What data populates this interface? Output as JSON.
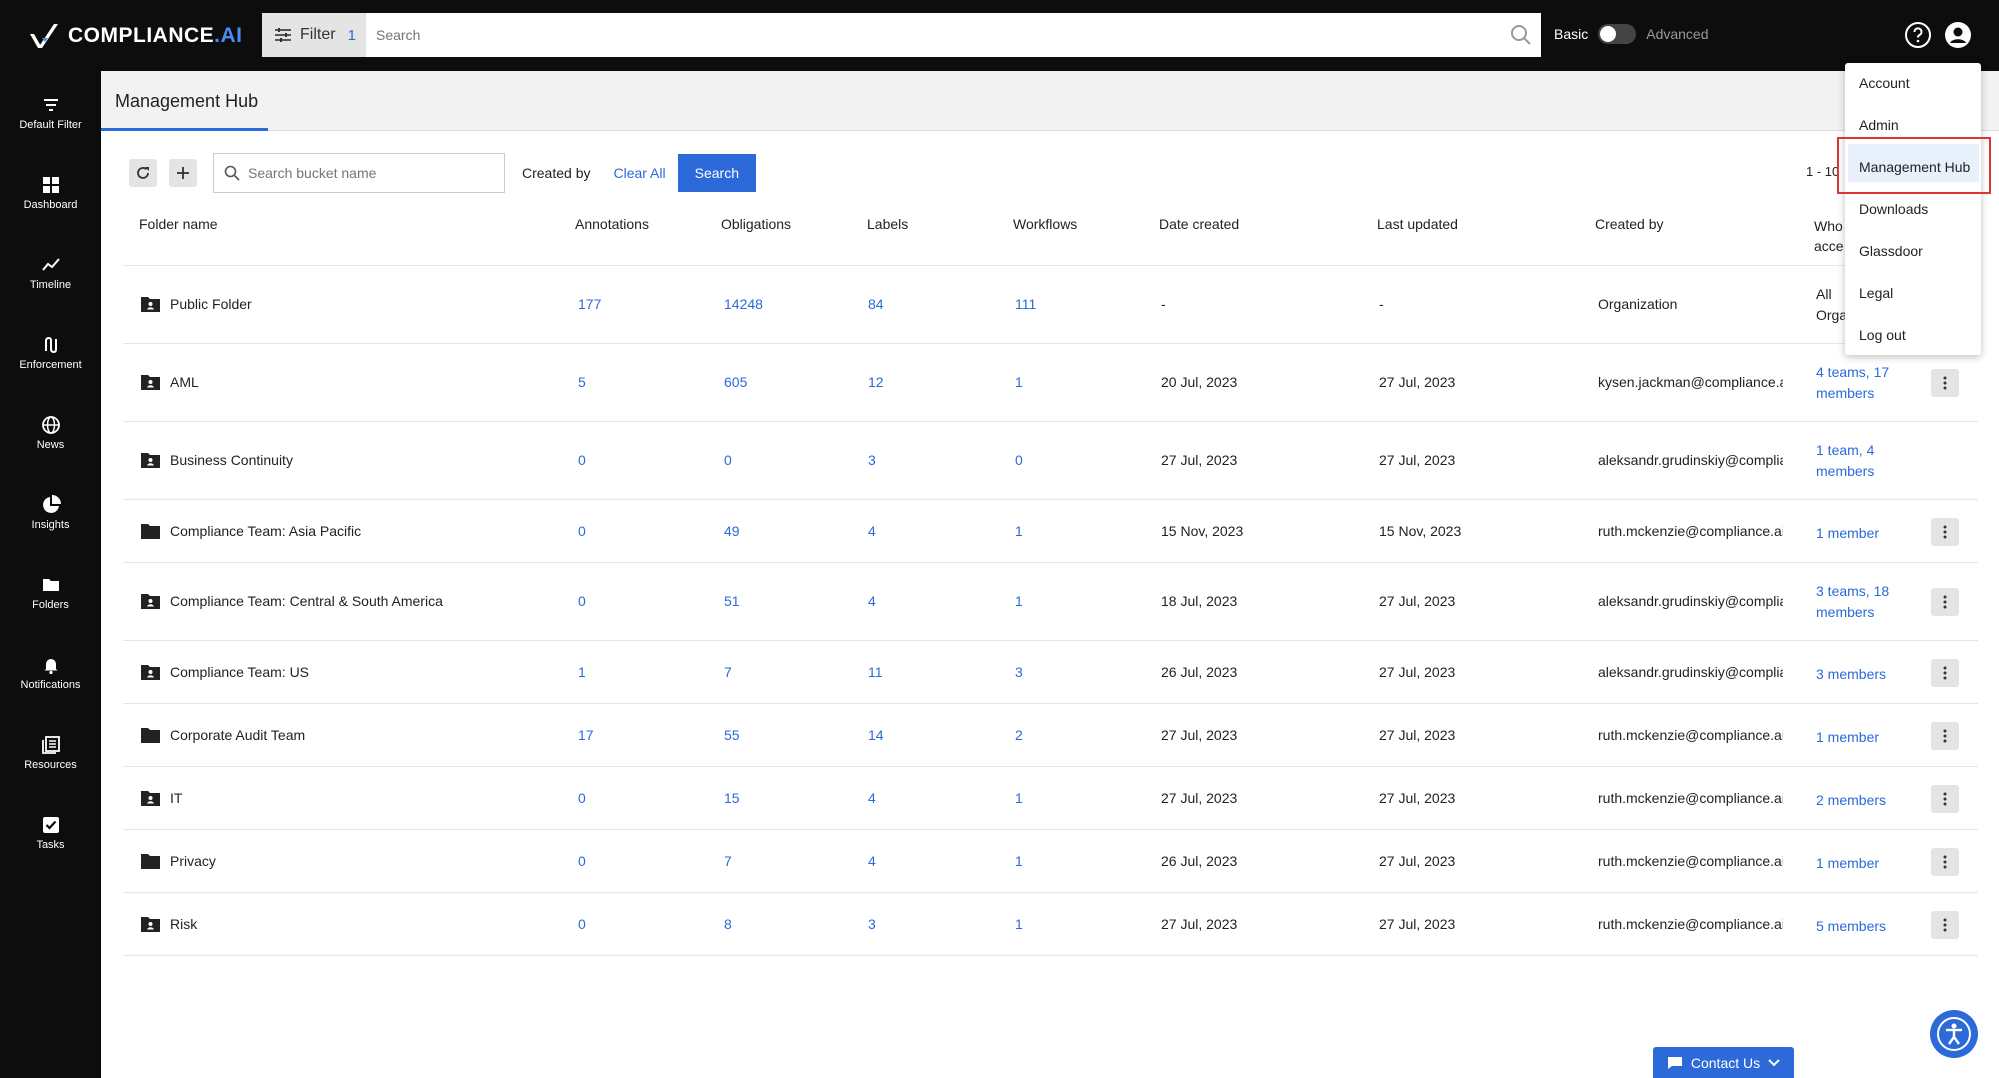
{
  "brand": {
    "name": "COMPLIANCE",
    "suffix": ".AI"
  },
  "search": {
    "filter_label": "Filter",
    "filter_count": "1",
    "placeholder": "Search"
  },
  "mode": {
    "basic": "Basic",
    "advanced": "Advanced"
  },
  "sidebar": {
    "items": [
      {
        "label": "Default Filter",
        "icon": "filter-lines-icon"
      },
      {
        "label": "Dashboard",
        "icon": "grid-icon"
      },
      {
        "label": "Timeline",
        "icon": "trend-line-icon"
      },
      {
        "label": "Enforcement",
        "icon": "gavel-icon"
      },
      {
        "label": "News",
        "icon": "globe-icon"
      },
      {
        "label": "Insights",
        "icon": "pie-chart-icon"
      },
      {
        "label": "Folders",
        "icon": "folder-icon"
      },
      {
        "label": "Notifications",
        "icon": "bell-icon"
      },
      {
        "label": "Resources",
        "icon": "document-stack-icon"
      },
      {
        "label": "Tasks",
        "icon": "checkbox-icon"
      }
    ]
  },
  "page": {
    "tab": "Management Hub"
  },
  "toolbar": {
    "bucket_placeholder": "Search bucket name",
    "created_by": "Created by",
    "clear_all": "Clear All",
    "search": "Search",
    "pagination": "1 - 10"
  },
  "table": {
    "headers": {
      "folder": "Folder name",
      "annotations": "Annotations",
      "obligations": "Obligations",
      "labels": "Labels",
      "workflows": "Workflows",
      "date_created": "Date created",
      "last_updated": "Last updated",
      "created_by": "Created by",
      "access_1": "Who",
      "access_2": "acce"
    },
    "rows": [
      {
        "name": "Public Folder",
        "shared": true,
        "annotations": "177",
        "obligations": "14248",
        "labels": "84",
        "workflows": "111",
        "created": "-",
        "updated": "-",
        "creator": "Organization",
        "access_1": "All",
        "access_2": "Orga",
        "menu": false
      },
      {
        "name": "AML",
        "shared": true,
        "annotations": "5",
        "obligations": "605",
        "labels": "12",
        "workflows": "1",
        "created": "20 Jul, 2023",
        "updated": "27 Jul, 2023",
        "creator": "kysen.jackman@compliance.a",
        "access_1": "4 teams, 17",
        "access_2": "members",
        "menu": true
      },
      {
        "name": "Business Continuity",
        "shared": true,
        "annotations": "0",
        "obligations": "0",
        "labels": "3",
        "workflows": "0",
        "created": "27 Jul, 2023",
        "updated": "27 Jul, 2023",
        "creator": "aleksandr.grudinskiy@complia",
        "access_1": "1 team, 4",
        "access_2": "members",
        "menu": false
      },
      {
        "name": "Compliance Team: Asia Pacific",
        "shared": false,
        "annotations": "0",
        "obligations": "49",
        "labels": "4",
        "workflows": "1",
        "created": "15 Nov, 2023",
        "updated": "15 Nov, 2023",
        "creator": "ruth.mckenzie@compliance.ai",
        "access_1": "1 member",
        "access_2": "",
        "menu": true
      },
      {
        "name": "Compliance Team: Central & South America",
        "shared": true,
        "annotations": "0",
        "obligations": "51",
        "labels": "4",
        "workflows": "1",
        "created": "18 Jul, 2023",
        "updated": "27 Jul, 2023",
        "creator": "aleksandr.grudinskiy@complia",
        "access_1": "3 teams, 18",
        "access_2": "members",
        "menu": true
      },
      {
        "name": "Compliance Team: US",
        "shared": true,
        "annotations": "1",
        "obligations": "7",
        "labels": "11",
        "workflows": "3",
        "created": "26 Jul, 2023",
        "updated": "27 Jul, 2023",
        "creator": "aleksandr.grudinskiy@complia",
        "access_1": "3 members",
        "access_2": "",
        "menu": true
      },
      {
        "name": "Corporate Audit Team",
        "shared": false,
        "annotations": "17",
        "obligations": "55",
        "labels": "14",
        "workflows": "2",
        "created": "27 Jul, 2023",
        "updated": "27 Jul, 2023",
        "creator": "ruth.mckenzie@compliance.ai",
        "access_1": "1 member",
        "access_2": "",
        "menu": true
      },
      {
        "name": "IT",
        "shared": true,
        "annotations": "0",
        "obligations": "15",
        "labels": "4",
        "workflows": "1",
        "created": "27 Jul, 2023",
        "updated": "27 Jul, 2023",
        "creator": "ruth.mckenzie@compliance.ai",
        "access_1": "2 members",
        "access_2": "",
        "menu": true
      },
      {
        "name": "Privacy",
        "shared": false,
        "annotations": "0",
        "obligations": "7",
        "labels": "4",
        "workflows": "1",
        "created": "26 Jul, 2023",
        "updated": "27 Jul, 2023",
        "creator": "ruth.mckenzie@compliance.ai",
        "access_1": "1 member",
        "access_2": "",
        "menu": true
      },
      {
        "name": "Risk",
        "shared": true,
        "annotations": "0",
        "obligations": "8",
        "labels": "3",
        "workflows": "1",
        "created": "27 Jul, 2023",
        "updated": "27 Jul, 2023",
        "creator": "ruth.mckenzie@compliance.ai",
        "access_1": "5 members",
        "access_2": "",
        "menu": true
      }
    ]
  },
  "user_menu": {
    "items": [
      "Account",
      "Admin",
      "Management Hub",
      "Downloads",
      "Glassdoor",
      "Legal",
      "Log out"
    ],
    "selected": "Management Hub"
  },
  "contact": {
    "label": "Contact Us"
  },
  "colors": {
    "accent": "#2b6ad8",
    "topbar": "#0d0d0d",
    "highlight_box": "#d93636"
  }
}
